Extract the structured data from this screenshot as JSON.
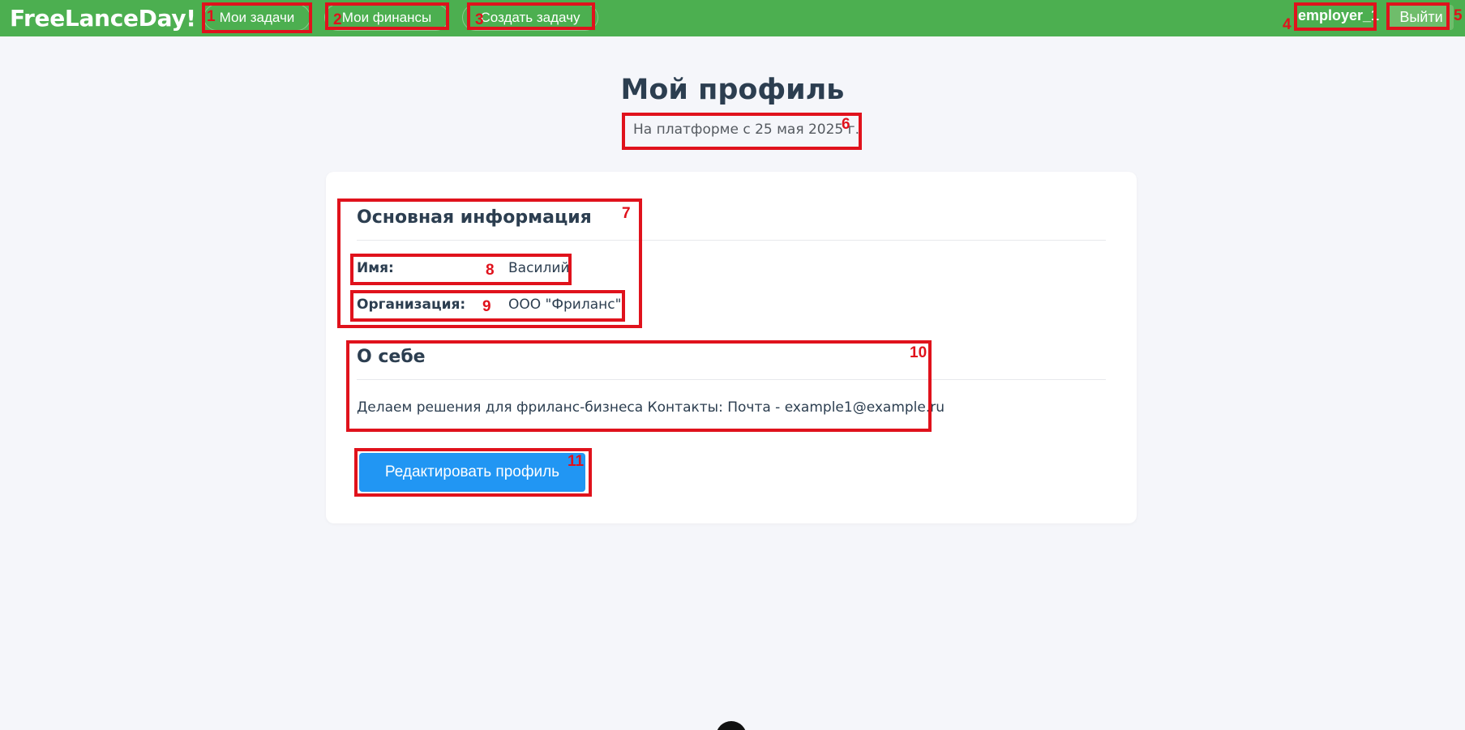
{
  "app": {
    "logo": "FreeLanceDay!"
  },
  "nav": {
    "items": [
      {
        "label": "Мои задачи",
        "marker": "1"
      },
      {
        "label": "Мои финансы",
        "marker": "2"
      },
      {
        "label": "Создать задачу",
        "marker": "3"
      }
    ],
    "username": "employer_1",
    "username_marker": "4",
    "logout_label": "Выйти",
    "logout_marker": "5"
  },
  "profile": {
    "title": "Мой профиль",
    "since": "На платформе с 25 мая 2025 г.",
    "since_marker": "6",
    "basic": {
      "title": "Основная информация",
      "marker": "7",
      "fields": [
        {
          "label": "Имя:",
          "value": "Василий",
          "marker": "8"
        },
        {
          "label": "Организация:",
          "value": "ООО \"Фриланс\"",
          "marker": "9"
        }
      ]
    },
    "about": {
      "title": "О себе",
      "marker": "10",
      "text": "Делаем решения для фриланс-бизнеса Контакты: Почта - example1@example.ru"
    },
    "edit_label": "Редактировать профиль",
    "edit_marker": "11"
  },
  "colors": {
    "topbar": "#4caf50",
    "primary_button": "#2196f3",
    "annotation": "#e0121c",
    "background": "#f5f6fa"
  }
}
